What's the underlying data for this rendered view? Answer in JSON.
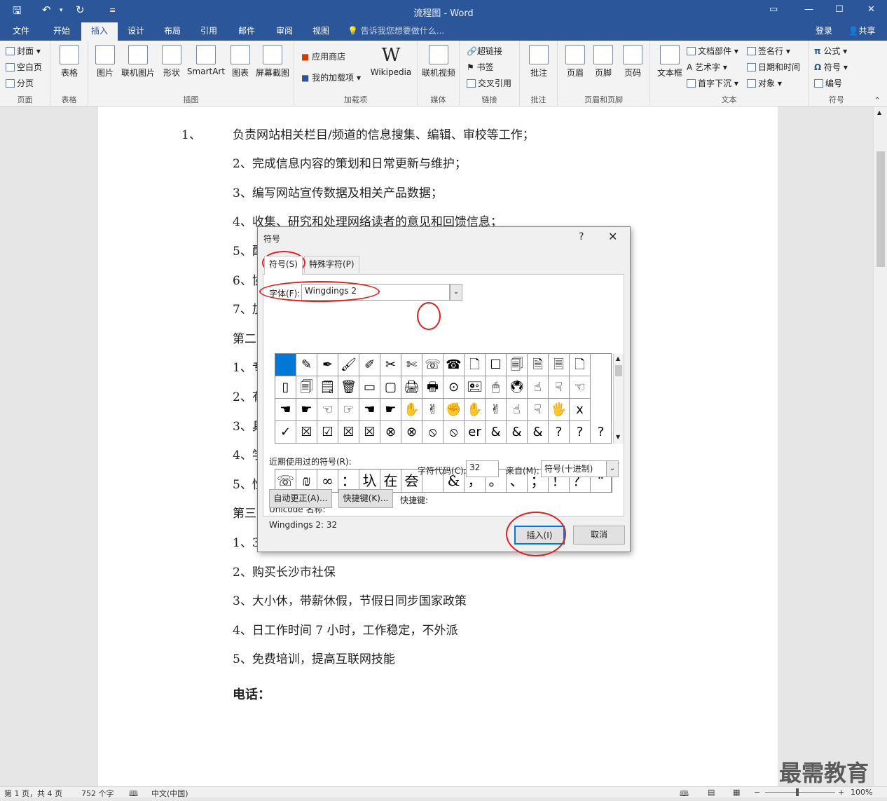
{
  "app": {
    "title": "流程图 - Word",
    "quick_access": [
      "save-icon",
      "undo-icon",
      "redo-icon",
      "customize-icon"
    ],
    "window_controls": [
      "ribbon-display-icon",
      "minimize-icon",
      "maximize-icon",
      "close-icon"
    ]
  },
  "tabs": [
    "文件",
    "开始",
    "插入",
    "设计",
    "布局",
    "引用",
    "邮件",
    "审阅",
    "视图"
  ],
  "active_tab": "插入",
  "tell_me": "告诉我您想要做什么...",
  "signin": "登录",
  "share": "共享",
  "ribbon": {
    "pages": {
      "label": "页面",
      "items": [
        "封面",
        "空白页",
        "分页"
      ]
    },
    "tables": {
      "label": "表格",
      "items": [
        "表格"
      ]
    },
    "illustrations": {
      "label": "插图",
      "items": [
        "图片",
        "联机图片",
        "形状",
        "SmartArt",
        "图表",
        "屏幕截图"
      ]
    },
    "addins": {
      "label": "加载项",
      "items": [
        "应用商店",
        "我的加载项",
        "Wikipedia"
      ]
    },
    "media": {
      "label": "媒体",
      "items": [
        "联机视频"
      ]
    },
    "links": {
      "label": "链接",
      "items": [
        "超链接",
        "书签",
        "交叉引用"
      ]
    },
    "comments": {
      "label": "批注",
      "items": [
        "批注"
      ]
    },
    "header_footer": {
      "label": "页眉和页脚",
      "items": [
        "页眉",
        "页脚",
        "页码"
      ]
    },
    "text": {
      "label": "文本",
      "items": [
        "文本框",
        "文档部件",
        "艺术字",
        "首字下沉",
        "签名行",
        "日期和时间",
        "对象"
      ]
    },
    "symbols": {
      "label": "符号",
      "items": [
        "公式",
        "符号",
        "编号"
      ]
    }
  },
  "document": {
    "lines": [
      {
        "num": "1、",
        "text": "负责网站相关栏目/频道的信息搜集、编辑、审校等工作；"
      },
      {
        "text": "2、完成信息内容的策划和日常更新与维护；"
      },
      {
        "text": "3、编写网站宣传数据及相关产品数据；"
      },
      {
        "text": "4、收集、研究和处理网络读者的意见和回馈信息；"
      },
      {
        "text": "5、配"
      },
      {
        "text": "6、协"
      },
      {
        "text": "7、加"
      },
      {
        "text": "第二"
      },
      {
        "text": "1、专"
      },
      {
        "text": "2、有"
      },
      {
        "text": "3、具"
      },
      {
        "text": "4、学"
      },
      {
        "text": "5、性"
      },
      {
        "text": "第三"
      },
      {
        "text": "1、3"
      },
      {
        "text": "2、购买长沙市社保"
      },
      {
        "text": "3、大小休，带薪休假，节假日同步国家政策"
      },
      {
        "text": "4、日工作时间 7 小时，工作稳定，不外派"
      },
      {
        "text": "5、免费培训，提高互联网技能"
      }
    ],
    "phone_label": "电话："
  },
  "dialog": {
    "title": "符号",
    "help": "?",
    "close": "✕",
    "tabs": [
      "符号(S)",
      "特殊字符(P)"
    ],
    "font_label": "字体(F):",
    "font_value": "Wingdings 2",
    "grid": [
      [
        "",
        "✎",
        "✒",
        "🖌",
        "✐",
        "✂",
        "✄",
        "☏",
        "☎",
        "🗋",
        "☐",
        "🗐",
        "🗎",
        "🗏",
        "🗋"
      ],
      [
        "▯",
        "🗐",
        "🗒",
        "🗑",
        "▭",
        "▢",
        "🖨",
        "🖶",
        "⊙",
        "🖭",
        "🖱",
        "🖲",
        "☝",
        "☟",
        "☜"
      ],
      [
        "☚",
        "☛",
        "☜",
        "☞",
        "☚",
        "☛",
        "✋",
        "✌",
        "✊",
        "✋",
        "✌",
        "☝",
        "☟",
        "🖐",
        "x"
      ],
      [
        "✓",
        "☒",
        "☑",
        "☒",
        "☒",
        "⊗",
        "⊗",
        "⦸",
        "⦸",
        "er",
        "&",
        "&",
        "&",
        "?",
        "?",
        "?"
      ]
    ],
    "recent_label": "近期使用过的符号(R):",
    "recent": [
      "☏",
      "₪",
      "∞",
      "：",
      "圦",
      "在",
      "夽",
      "",
      "&",
      "，",
      "。",
      "、",
      "；",
      "！",
      "？",
      "“"
    ],
    "unicode_label": "Unicode 名称:",
    "unicode_value": "Wingdings 2: 32",
    "charcode_label": "字符代码(C):",
    "charcode_value": "32",
    "from_label": "来自(M):",
    "from_value": "符号(十进制)",
    "autocorrect_button": "自动更正(A)...",
    "shortcut_button": "快捷键(K)...",
    "shortcut_label": "快捷键:",
    "insert_button": "插入(I)",
    "cancel_button": "取消"
  },
  "status": {
    "page": "第 1 页，共 4 页",
    "words": "752 个字",
    "lang": "中文(中国)",
    "zoom": "100%"
  },
  "watermark": "最需教育"
}
